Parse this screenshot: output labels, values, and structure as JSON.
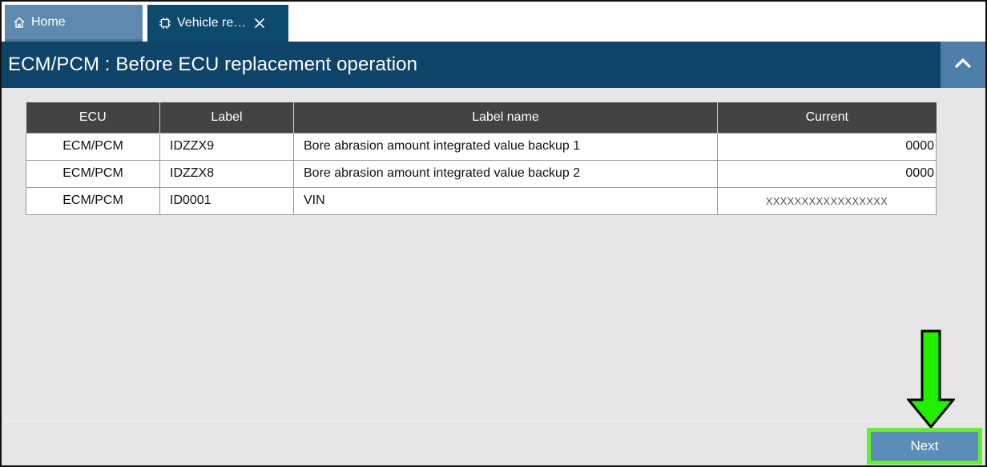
{
  "tabs": {
    "home_label": "Home",
    "home_icon": "home-icon",
    "vehicle_label": "Vehicle re…",
    "vehicle_icon": "chip-icon",
    "close_icon": "close-icon"
  },
  "header": {
    "title": "ECM/PCM : Before ECU replacement operation",
    "collapse_icon": "chevron-up-icon"
  },
  "table": {
    "columns": [
      "ECU",
      "Label",
      "Label name",
      "Current"
    ],
    "rows": [
      {
        "ecu": "ECM/PCM",
        "label": "IDZZX9",
        "label_name": "Bore abrasion amount integrated value backup 1",
        "current": "0000"
      },
      {
        "ecu": "ECM/PCM",
        "label": "IDZZX8",
        "label_name": "Bore abrasion amount integrated value backup 2",
        "current": "0000"
      },
      {
        "ecu": "ECM/PCM",
        "label": "ID0001",
        "label_name": "VIN",
        "current": "XXXXXXXXXXXXXXXXX"
      }
    ]
  },
  "footer": {
    "next_label": "Next",
    "highlight_color": "#66ee33",
    "arrow_icon": "down-arrow-icon"
  }
}
